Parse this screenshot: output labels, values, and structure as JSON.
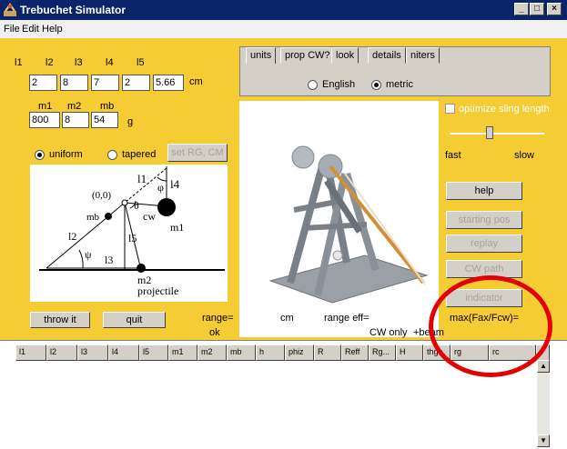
{
  "window": {
    "title": "Trebuchet Simulator",
    "min": "_",
    "max": "□",
    "close": "×"
  },
  "menu": [
    "File",
    "Edit",
    "Help"
  ],
  "lengths": {
    "labels": [
      "l1",
      "l2",
      "l3",
      "l4",
      "l5"
    ],
    "values": [
      "2",
      "8",
      "7",
      "2",
      "5.66"
    ],
    "unit": "cm"
  },
  "masses": {
    "labels": [
      "m1",
      "m2",
      "mb"
    ],
    "values": [
      "800",
      "8",
      "54"
    ],
    "unit": "g"
  },
  "beam": {
    "uniform": "uniform",
    "tapered": "tapered",
    "set_button": "set RG, CM"
  },
  "diagram": {
    "origin": "(0,0)",
    "l1": "l1",
    "l4": "l4",
    "phi": "φ",
    "theta": "θ",
    "cw": "cw",
    "mb": "mb",
    "m1": "m1",
    "l2": "l2",
    "psi": "ψ",
    "l5": "l5",
    "l3": "l3",
    "m2": "m2",
    "projectile": "projectile"
  },
  "tabs": [
    "units",
    "prop CW?",
    "look",
    "details",
    "niters"
  ],
  "units_radio": {
    "english": "English",
    "metric": "metric"
  },
  "sling": {
    "optimize": "optimize sling length",
    "fast": "fast",
    "slow": "slow"
  },
  "buttons": {
    "help": "help",
    "starting_pos": "starting pos",
    "replay": "replay",
    "cw_path": "CW path",
    "indicator": "indicator",
    "throw": "throw it",
    "quit": "quit"
  },
  "status": {
    "range": "range=",
    "cm": "cm",
    "range_eff": "range  eff=",
    "ok": "ok",
    "cw_only": "CW only",
    "plus_beam": "+beam",
    "max_ratio": "max(Fax/Fcw)="
  },
  "table_headers": [
    "l1",
    "l2",
    "l3",
    "l4",
    "l5",
    "m1",
    "m2",
    "mb",
    "h",
    "phiz",
    "R",
    "Reff",
    "Rg...",
    "H",
    "thgo",
    "rg",
    "rc"
  ],
  "colors": {
    "panel": "#f5cc33",
    "titlebar": "#0a246a",
    "annotation": "#e40000"
  }
}
